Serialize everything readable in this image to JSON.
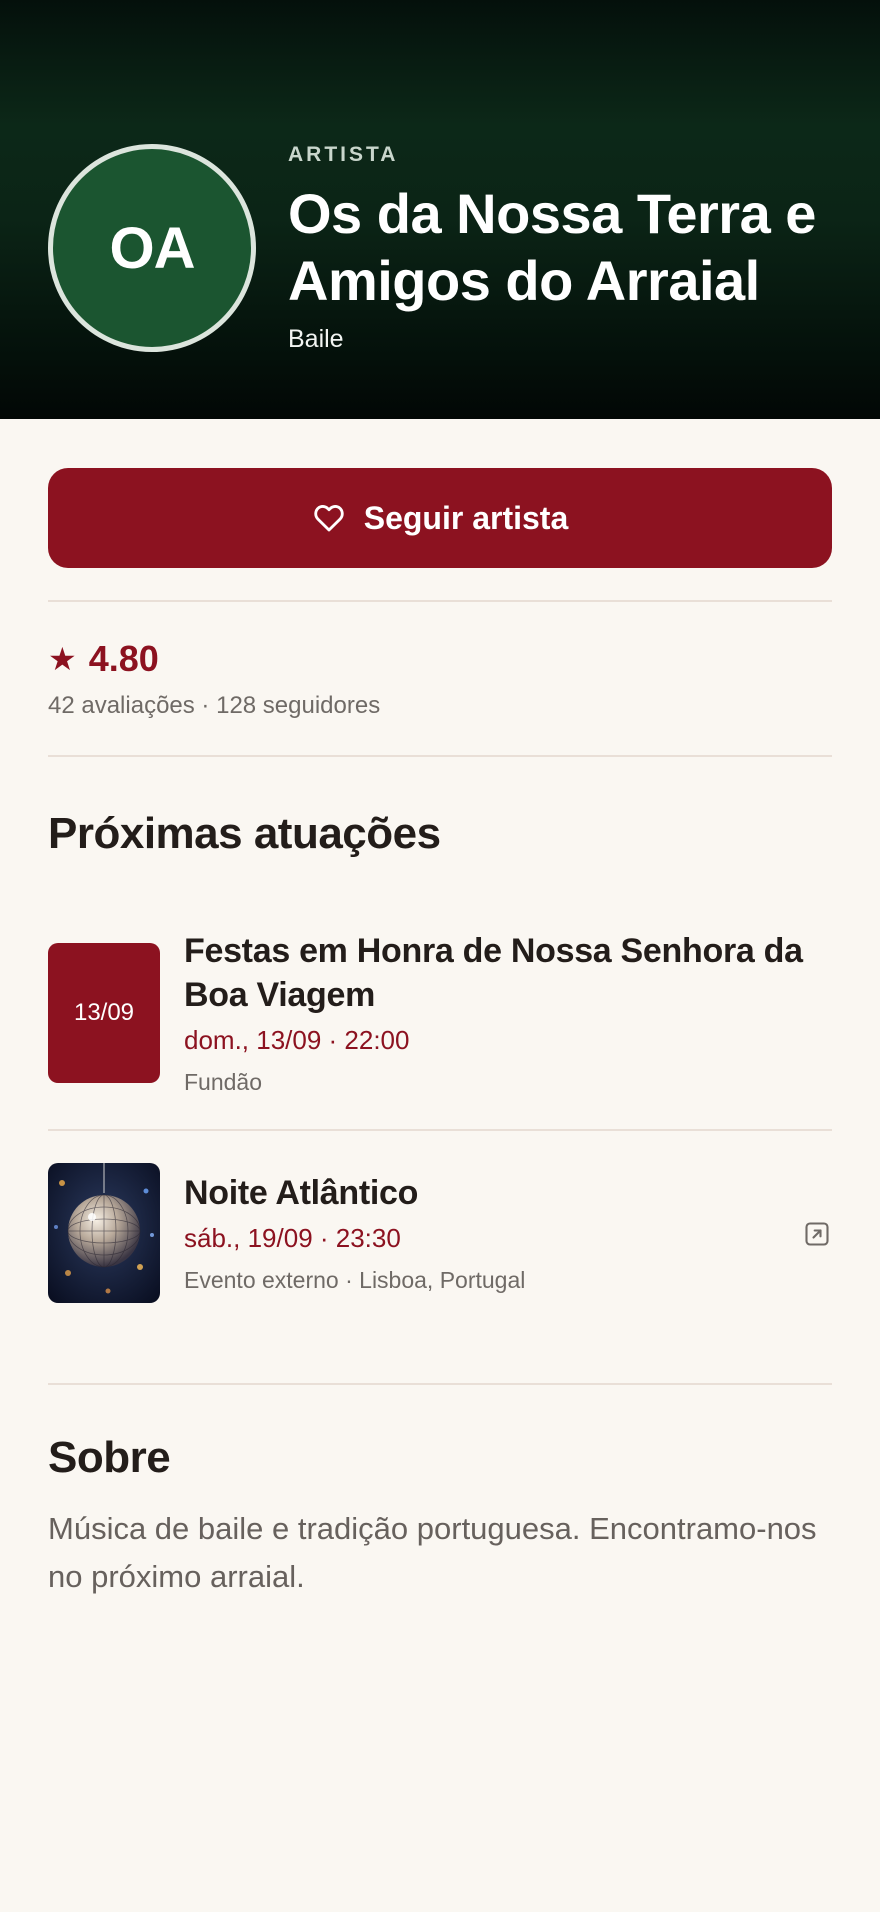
{
  "header": {
    "avatar_initials": "OA",
    "eyebrow": "ARTISTA",
    "artist_name": "Os da Nossa Terra e Amigos do Arraial",
    "genre": "Baile"
  },
  "follow": {
    "label": "Seguir artista",
    "icon": "heart-outline-icon"
  },
  "rating": {
    "icon": "star-icon",
    "value": "4.80",
    "meta": "42 avaliações · 128 seguidores"
  },
  "upcoming": {
    "title": "Próximas atuações",
    "events": [
      {
        "thumb_label": "13/09",
        "title": "Festas em Honra de Nossa Senhora da Boa Viagem",
        "date": "dom., 13/09 · 22:00",
        "meta": "Fundão"
      },
      {
        "thumb_icon": "disco-ball-image",
        "title": "Noite Atlântico",
        "date": "sáb., 19/09 · 23:30",
        "meta": "Evento externo · Lisboa, Portugal",
        "link_icon": "external-link-icon"
      }
    ]
  },
  "about": {
    "title": "Sobre",
    "text": "Música de baile e tradição portuguesa. Encontramo-nos no próximo arraial."
  },
  "colors": {
    "accent": "#8c1220",
    "hero_green": "#1b5530",
    "background": "#faf7f2"
  }
}
